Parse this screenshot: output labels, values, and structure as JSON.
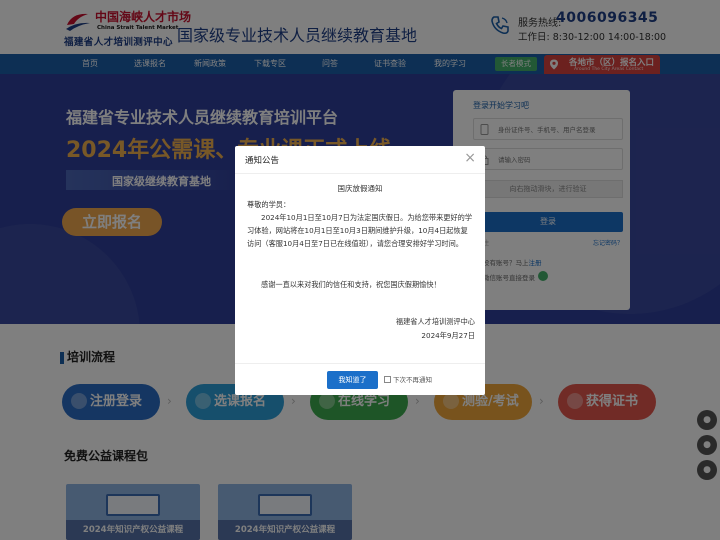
{
  "header": {
    "logo_cn": "中国海峡人才市场",
    "logo_en": "China Strait Talent Market",
    "logo_sub": "福建省人才培训测评中心",
    "site_title": "国家级专业技术人员继续教育基地",
    "hotline_label": "服务热线:",
    "hotline_number": "4006096345",
    "hours": "工作日:  8:30-12:00  14:00-18:00"
  },
  "nav": {
    "items": [
      "首页",
      "选课报名",
      "新闻政策",
      "下载专区",
      "问答",
      "证书查验",
      "我的学习"
    ],
    "elder_mode": "长者模式",
    "city_entry": "各地市（区）报名入口",
    "city_entry_en": "Around The City Areas Contact"
  },
  "banner": {
    "title1": "福建省专业技术人员继续教育培训平台",
    "title2": "2024年公需课、专业课正式上线",
    "title3": "国家级继续教育基地",
    "cta": "立即报名"
  },
  "login": {
    "title": "登录开始学习吧",
    "account_placeholder": "身份证件号、手机号、用户名登录",
    "password_placeholder": "请输入密码",
    "slider_text": "向右拖动滑块，进行验证",
    "login_button": "登录",
    "remember": "记住",
    "forgot": "忘记密码？",
    "no_account": "没有账号？马上",
    "register": "注册",
    "wechat": "微信账号直接登录"
  },
  "process": {
    "title": "培训流程",
    "steps": [
      {
        "label": "注册登录",
        "color": "#2b6cc4"
      },
      {
        "label": "选课报名",
        "color": "#2c9ed8"
      },
      {
        "label": "在线学习",
        "color": "#3cab4e"
      },
      {
        "label": "测验/考试",
        "color": "#f0a63a"
      },
      {
        "label": "获得证书",
        "color": "#e2574c"
      }
    ]
  },
  "courses": {
    "title": "免费公益课程包",
    "items": [
      "2024年知识产权公益课程",
      "2024年知识产权公益课程"
    ]
  },
  "modal": {
    "title": "通知公告",
    "heading": "国庆放假通知",
    "greeting": "尊敬的学员：",
    "body": "2024年10月1日至10月7日为法定国庆假日。为给您带来更好的学习体验，网站将在10月1日至10月3日期间维护升级，10月4日起恢复访问（客服10月4日至7日已在线值班），请您合理安排好学习时间。",
    "thanks": "感谢一直以来对我们的信任和支持，祝您国庆假期愉快！",
    "signature": "福建省人才培训测评中心",
    "date": "2024年9月27日",
    "ok_button": "我知道了",
    "dont_show": "下次不再通知"
  }
}
